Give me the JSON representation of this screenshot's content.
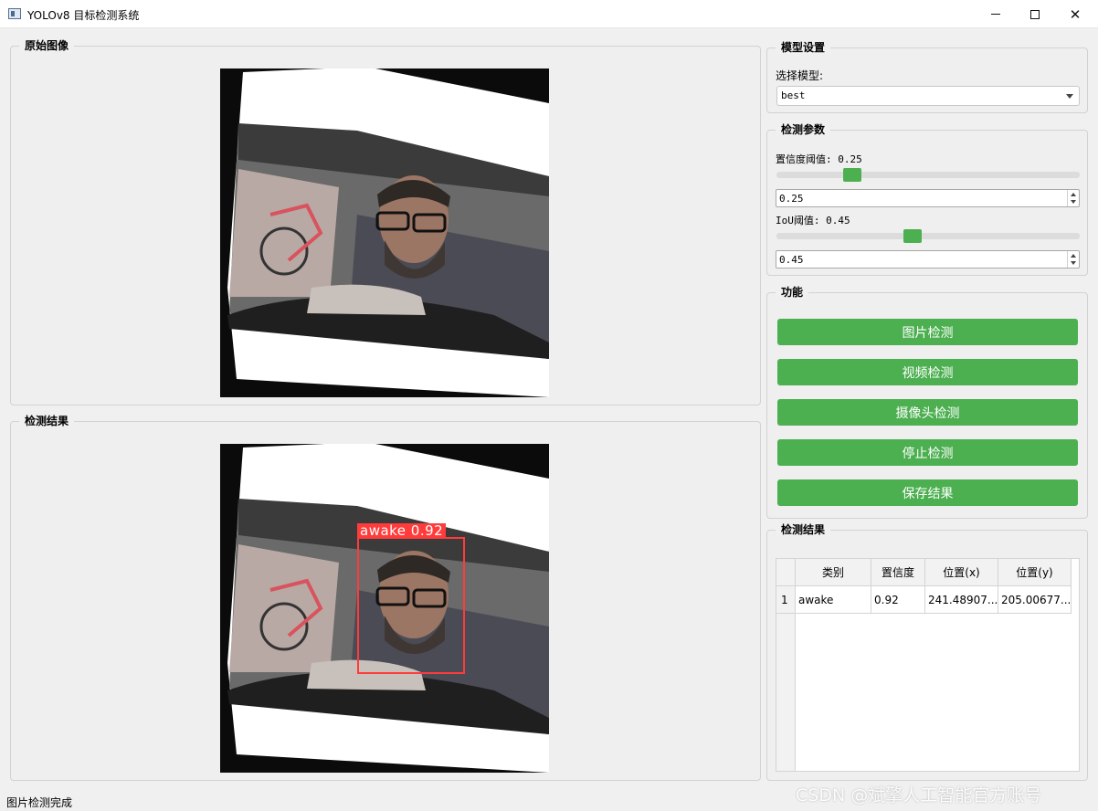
{
  "window": {
    "title": "YOLOv8 目标检测系统"
  },
  "original_panel": {
    "title": "原始图像"
  },
  "result_panel": {
    "title": "检测结果"
  },
  "detection_overlay": {
    "label": "awake 0.92",
    "color": "#ff3b3b"
  },
  "model_settings": {
    "title": "模型设置",
    "select_label": "选择模型:",
    "selected_model": "best"
  },
  "detect_params": {
    "title": "检测参数",
    "conf_label": "置信度阈值: 0.25",
    "conf_value": "0.25",
    "conf_fraction": 0.25,
    "iou_label": "IoU阈值: 0.45",
    "iou_value": "0.45",
    "iou_fraction": 0.45
  },
  "functions": {
    "title": "功能",
    "buttons": [
      "图片检测",
      "视频检测",
      "摄像头检测",
      "停止检测",
      "保存结果"
    ],
    "button_color": "#4caf50"
  },
  "results_table": {
    "title": "检测结果",
    "headers": [
      "类别",
      "置信度",
      "位置(x)",
      "位置(y)"
    ],
    "rows": [
      {
        "index": "1",
        "cells": [
          "awake",
          "0.92",
          "241.48907...",
          "205.00677..."
        ]
      }
    ]
  },
  "status": {
    "text": "图片检测完成"
  },
  "watermark": "CSDN @斌擎人工智能官方账号",
  "icons": [
    "app-window-icon",
    "minimize-icon",
    "maximize-icon",
    "close-icon",
    "dropdown-arrow-icon",
    "spin-up-icon",
    "spin-down-icon"
  ]
}
